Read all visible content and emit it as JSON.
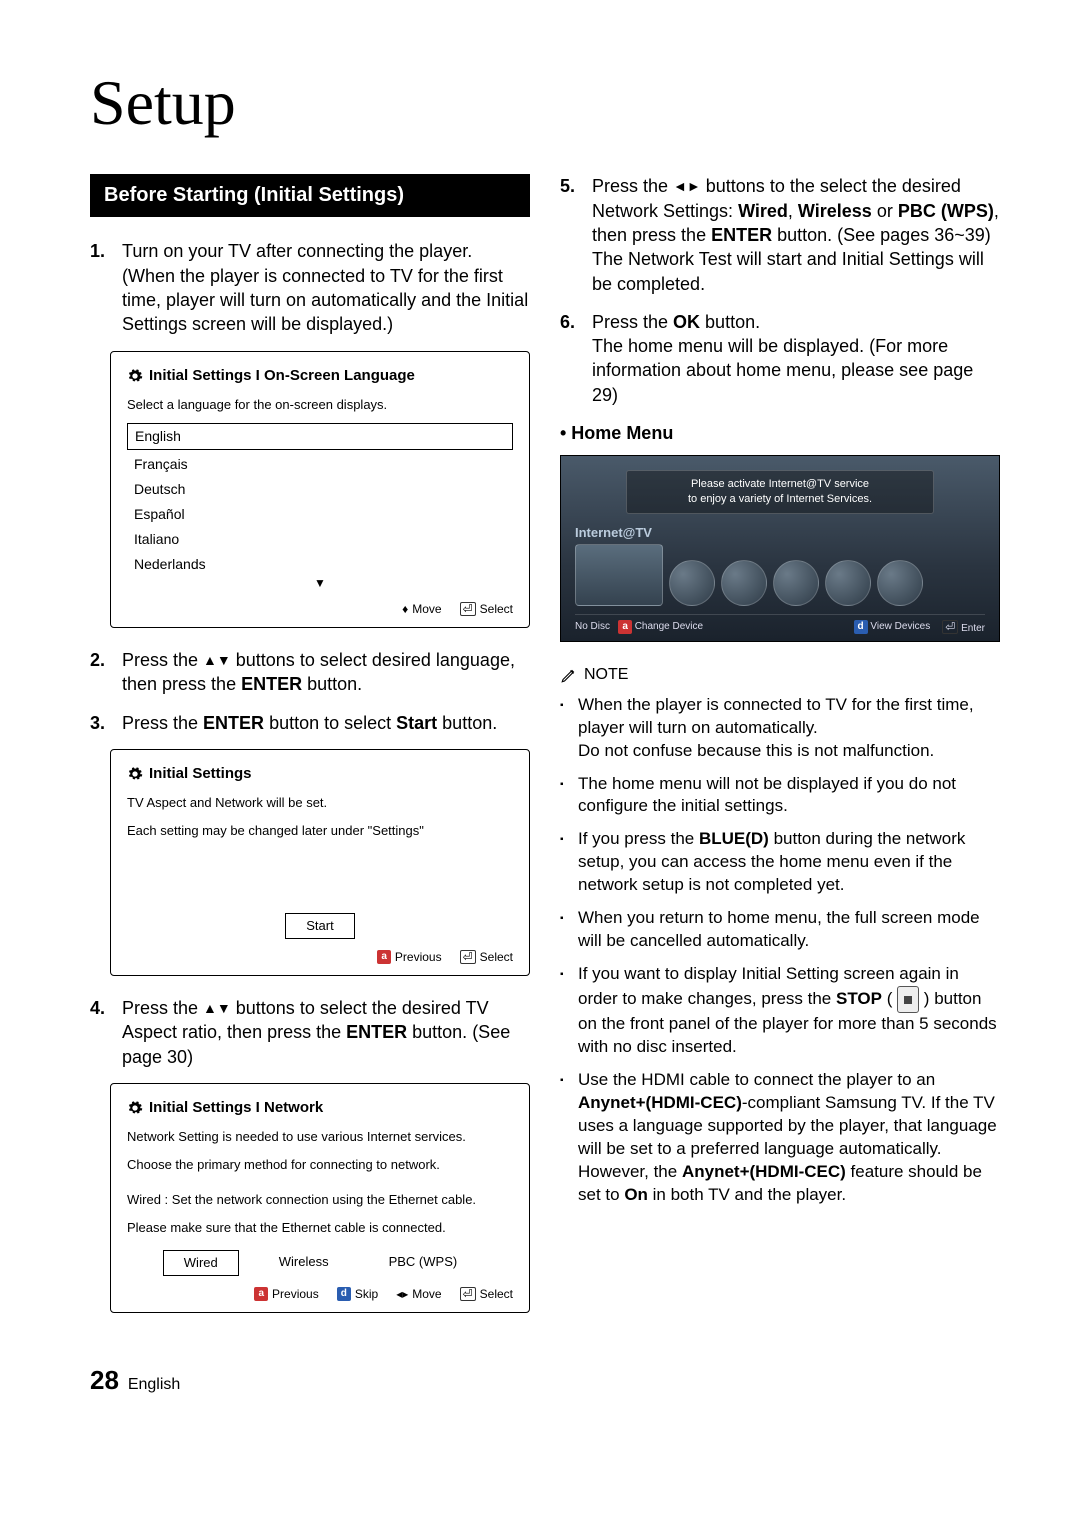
{
  "chapter_title": "Setup",
  "section_heading": "Before Starting (Initial Settings)",
  "steps_left": {
    "s1": {
      "num": "1.",
      "text": "Turn on your TV after connecting the player. (When the player is connected to TV for the first time, player will turn on automatically and the Initial Settings screen will be displayed.)"
    },
    "s2": {
      "num": "2.",
      "pre": "Press the ",
      "arrows": "▲▼",
      "mid": " buttons to select desired language, then press the ",
      "bold1": "ENTER",
      "post": " button."
    },
    "s3": {
      "num": "3.",
      "pre": "Press the ",
      "bold1": "ENTER",
      "mid": " button to select ",
      "bold2": "Start",
      "post": " button."
    },
    "s4": {
      "num": "4.",
      "pre": "Press the ",
      "arrows": "▲▼",
      "mid": " buttons to select the desired TV Aspect ratio, then press the ",
      "bold1": "ENTER",
      "post": " button. (See page 30)"
    }
  },
  "steps_right": {
    "s5": {
      "num": "5.",
      "pre": "Press the ",
      "arrows": "◄►",
      "mid": " buttons to the select the desired Network Settings: ",
      "b1": "Wired",
      "sep1": ", ",
      "b2": "Wireless",
      "sep2": " or ",
      "b3": "PBC (WPS)",
      "mid2": ", then press the ",
      "b4": "ENTER",
      "post": " button. (See pages 36~39)",
      "line2": "The Network Test will start and Initial Settings will be completed."
    },
    "s6": {
      "num": "6.",
      "pre": "Press the ",
      "b1": "OK",
      "mid": " button.",
      "line2": "The home menu will be displayed. (For more information about home menu, please see page 29)"
    }
  },
  "home_menu_head": "• Home Menu",
  "fig_lang": {
    "title": "Initial Settings I On-Screen Language",
    "desc": "Select a language for the on-screen displays.",
    "items": [
      "English",
      "Français",
      "Deutsch",
      "Español",
      "Italiano",
      "Nederlands"
    ],
    "footer_move": "Move",
    "footer_select": "Select"
  },
  "fig_start": {
    "title": "Initial Settings",
    "desc1": "TV Aspect and Network will be set.",
    "desc2": "Each setting may be changed later under \"Settings\"",
    "btn": "Start",
    "footer_prev": "Previous",
    "footer_select": "Select"
  },
  "fig_net": {
    "title": "Initial Settings I Network",
    "desc1": "Network Setting is needed to use various Internet services.",
    "desc2": "Choose the primary method for connecting to network.",
    "desc3": "Wired : Set the network connection using the Ethernet cable.",
    "desc4": "Please make sure that the Ethernet cable is connected.",
    "btns": [
      "Wired",
      "Wireless",
      "PBC (WPS)"
    ],
    "footer_prev": "Previous",
    "footer_skip": "Skip",
    "footer_move": "Move",
    "footer_select": "Select"
  },
  "fig_home": {
    "banner1": "Please activate Internet@TV service",
    "banner2": "to enjoy a variety of Internet Services.",
    "label": "Internet@TV",
    "footer_left": "No Disc",
    "footer_change": "Change Device",
    "footer_view": "View Devices",
    "footer_enter": "Enter"
  },
  "note_label": "NOTE",
  "notes": {
    "n1a": "When the player is connected to TV for the first time, player will turn on automatically.",
    "n1b": "Do not confuse because this is not malfunction.",
    "n2": "The home menu will not be displayed if you do not configure the initial settings.",
    "n3a": "If you press the ",
    "n3bold": "BLUE(D)",
    "n3b": " button during the network setup, you can access the home menu even if the network setup is not completed yet.",
    "n4": "When you return to home menu, the full screen mode will be cancelled automatically.",
    "n5a": "If you want to display Initial Setting screen again in order to make changes, press the ",
    "n5bold": "STOP",
    "n5b": " button on the front panel of the player for more than 5 seconds with no disc inserted.",
    "n6a": "Use the HDMI cable to connect the player to an ",
    "n6bold1": "Anynet+(HDMI-CEC)",
    "n6b": "-compliant Samsung TV. If the TV uses a language supported by the player, that language will be set to a preferred language automatically.",
    "n6c": "However, the ",
    "n6bold2": "Anynet+(HDMI-CEC)",
    "n6d": " feature should be set to ",
    "n6bold3": "On",
    "n6e": " in both TV and the player."
  },
  "footer": {
    "page": "28",
    "lang": "English"
  }
}
